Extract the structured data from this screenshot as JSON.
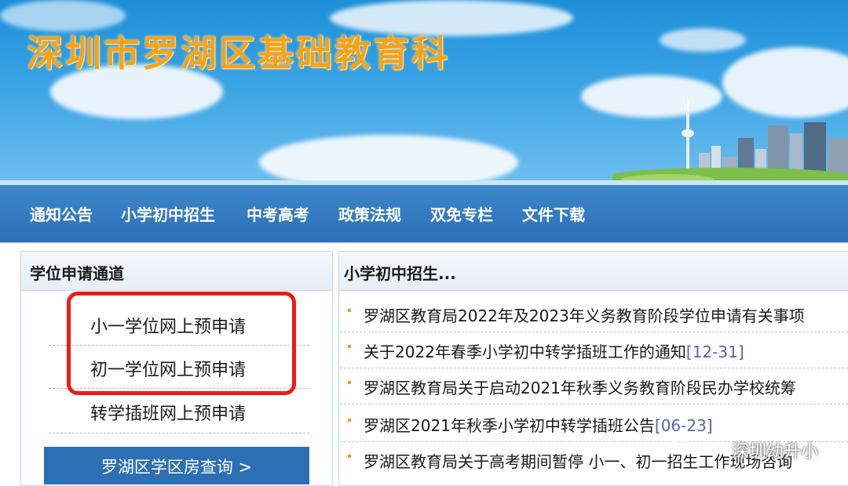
{
  "site": {
    "title": "深圳市罗湖区基础教育科"
  },
  "nav": {
    "items": [
      {
        "label": "通知公告"
      },
      {
        "label": "小学初中招生"
      },
      {
        "label": "中考高考"
      },
      {
        "label": "政策法规"
      },
      {
        "label": "双免专栏"
      },
      {
        "label": "文件下载"
      }
    ]
  },
  "left_panel": {
    "title": "学位申请通道",
    "links": [
      {
        "label": "小一学位网上预申请"
      },
      {
        "label": "初一学位网上预申请"
      },
      {
        "label": "转学插班网上预申请"
      }
    ],
    "query_button": "罗湖区学区房查询 >"
  },
  "right_panel": {
    "title": "小学初中招生...",
    "news": [
      {
        "title": "罗湖区教育局2022年及2023年义务教育阶段学位申请有关事项",
        "date": ""
      },
      {
        "title": "关于2022年春季小学初中转学插班工作的通知",
        "date": "[12-31]"
      },
      {
        "title": "罗湖区教育局关于启动2021年秋季义务教育阶段民办学校统筹",
        "date": ""
      },
      {
        "title": "罗湖区2021年秋季小学初中转学插班公告",
        "date": "[06-23]"
      },
      {
        "title": "罗湖区教育局关于高考期间暂停 小一、初一招生工作现场咨询",
        "date": ""
      }
    ]
  },
  "watermark": {
    "icon": "wechat-icon",
    "text": "深圳幼升小"
  },
  "colors": {
    "title_orange": "#f7a11a",
    "nav_blue": "#2b70b8",
    "highlight_red": "#ee1b1b",
    "bullet_orange": "#f29a1c",
    "date_blue": "#5a64b0"
  }
}
